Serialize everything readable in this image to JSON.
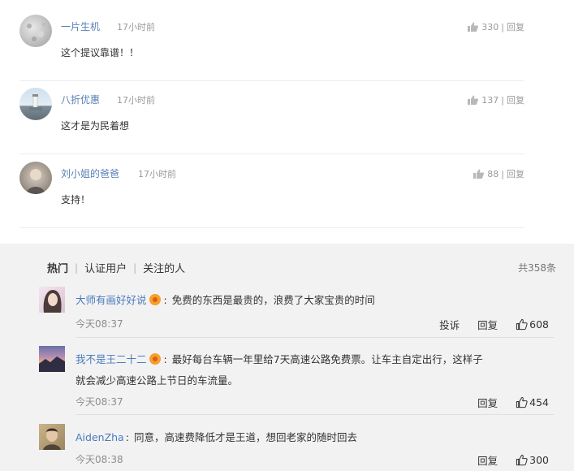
{
  "top_comments": [
    {
      "user": "一片生机",
      "time": "17小时前",
      "text": "这个提议靠谱！！",
      "likes": "330",
      "reply": "回复",
      "avatar": "gray-gradient-avatar"
    },
    {
      "user": "八折优惠",
      "time": "17小时前",
      "text": "这才是为民着想",
      "likes": "137",
      "reply": "回复",
      "avatar": "lighthouse-photo-avatar"
    },
    {
      "user": "刘小姐的爸爸",
      "time": "17小时前",
      "text": "支持！",
      "likes": "88",
      "reply": "回复",
      "avatar": "child-photo-avatar"
    }
  ],
  "tabs": [
    {
      "label": "热门",
      "active": true
    },
    {
      "label": "认证用户",
      "active": false
    },
    {
      "label": "关注的人",
      "active": false
    }
  ],
  "total_count": "共358条",
  "bottom_comments": [
    {
      "user": "大师有画好好说",
      "has_badge": true,
      "text_lines": [
        "免费的东西是最贵的，浪费了大家宝贵的时间"
      ],
      "time": "今天08:37",
      "actions": [
        "投诉",
        "回复"
      ],
      "likes": "608",
      "avatar": "woman-photo-avatar"
    },
    {
      "user": "我不是王二十二",
      "has_badge": true,
      "text_lines": [
        "最好每台车辆一年里给7天高速公路免费票。让车主自定出行，这样子",
        "就会减少高速公路上节日的车流量。"
      ],
      "time": "今天08:37",
      "actions": [
        "回复"
      ],
      "likes": "454",
      "avatar": "sunset-landscape-avatar"
    },
    {
      "user": "AidenZha",
      "has_badge": false,
      "text_lines": [
        "同意，高速费降低才是王道，想回老家的随时回去"
      ],
      "time": "今天08:38",
      "actions": [
        "回复"
      ],
      "likes": "300",
      "avatar": "man-photo-avatar"
    }
  ],
  "colors": {
    "top_username": "#5a7fb5",
    "bottom_username": "#4a7bbf",
    "bottom_background": "#f2f2f2",
    "badge": "#f5a02a"
  }
}
